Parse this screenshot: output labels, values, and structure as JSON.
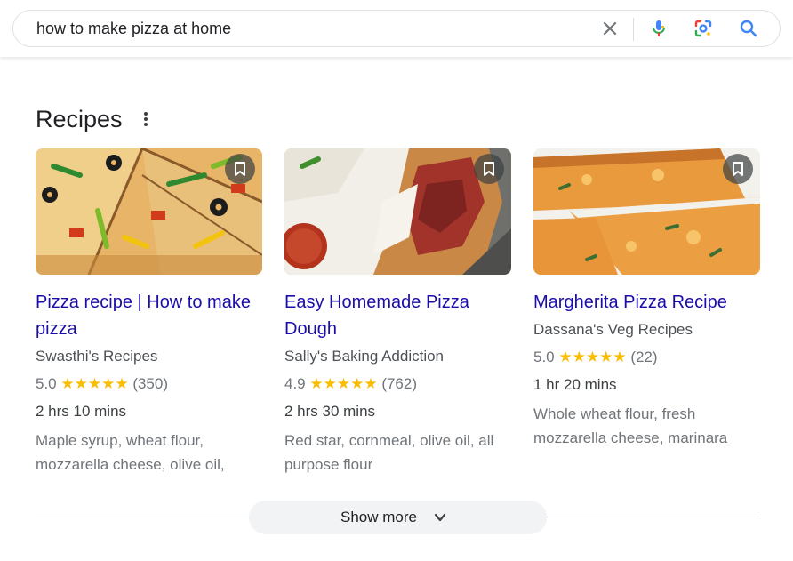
{
  "search": {
    "query": "how to make pizza at home"
  },
  "recipes": {
    "heading": "Recipes",
    "cards": [
      {
        "title": "Pizza recipe | How to make pizza",
        "source": "Swasthi's Recipes",
        "rating": "5.0",
        "stars": "★★★★★",
        "reviews": "(350)",
        "time": "2 hrs 10 mins",
        "ingredients": "Maple syrup, wheat flour, mozzarella cheese, olive oil,"
      },
      {
        "title": "Easy Homemade Pizza Dough",
        "source": "Sally's Baking Addiction",
        "rating": "4.9",
        "stars": "★★★★★",
        "reviews": "(762)",
        "time": "2 hrs 30 mins",
        "ingredients": "Red star, cornmeal, olive oil, all purpose flour"
      },
      {
        "title": "Margherita Pizza Recipe",
        "source": "Dassana's Veg Recipes",
        "rating": "5.0",
        "stars": "★★★★★",
        "reviews": "(22)",
        "time": "1 hr 20 mins",
        "ingredients": "Whole wheat flour, fresh mozzarella cheese, marinara"
      }
    ],
    "show_more": "Show more"
  },
  "colors": {
    "link": "#1a0dab",
    "star": "#fbbc04",
    "mic_blue": "#4285f4",
    "mic_red": "#ea4335"
  },
  "icons": [
    "clear-icon",
    "microphone-icon",
    "lens-icon",
    "search-icon",
    "more-vert-icon",
    "bookmark-icon",
    "chevron-down-icon"
  ]
}
